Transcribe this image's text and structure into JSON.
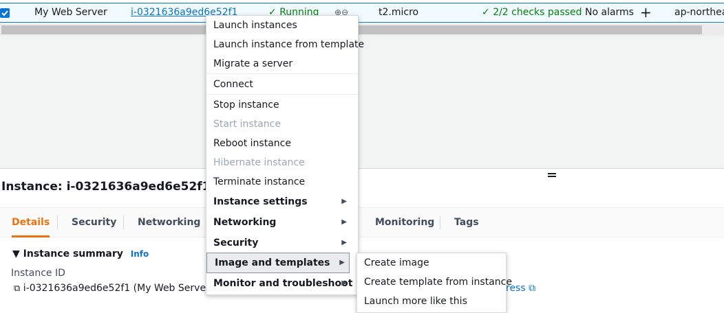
{
  "table_row": {
    "name": "My Web Server",
    "instance_id": "i-0321636a9ed6e52f1",
    "state": "Running",
    "type": "t2.micro",
    "status_check": "2/2 checks passed",
    "alarm_status": "No alarms",
    "add_alarm": "+",
    "zone": "ap-northea"
  },
  "details": {
    "title": "Instance: i-0321636a9ed6e52f1 (My",
    "tabs": [
      "Details",
      "Security",
      "Networking",
      "Monitoring",
      "Tags"
    ],
    "summary_heading": "Instance summary",
    "summary_info": "Info",
    "instance_id_label": "Instance ID",
    "instance_id_value": "i-0321636a9ed6e52f1 (My Web Server)",
    "address_link_fragment": "ress"
  },
  "context_menu": {
    "items": [
      {
        "label": "Launch instances"
      },
      {
        "label": "Launch instance from template"
      },
      {
        "label": "Migrate a server"
      },
      {
        "label": "Connect"
      },
      {
        "label": "Stop instance"
      },
      {
        "label": "Start instance",
        "disabled": true
      },
      {
        "label": "Reboot instance"
      },
      {
        "label": "Hibernate instance",
        "disabled": true
      },
      {
        "label": "Terminate instance"
      },
      {
        "label": "Instance settings",
        "submenu": true
      },
      {
        "label": "Networking",
        "submenu": true
      },
      {
        "label": "Security",
        "submenu": true
      },
      {
        "label": "Image and templates",
        "submenu": true,
        "selected": true
      },
      {
        "label": "Monitor and troubleshoot",
        "submenu": true
      }
    ]
  },
  "submenu": {
    "items": [
      "Create image",
      "Create template from instance",
      "Launch more like this"
    ]
  },
  "colors": {
    "accent": "#0972d3",
    "active_tab": "#ec7211",
    "success": "#037f0c"
  }
}
